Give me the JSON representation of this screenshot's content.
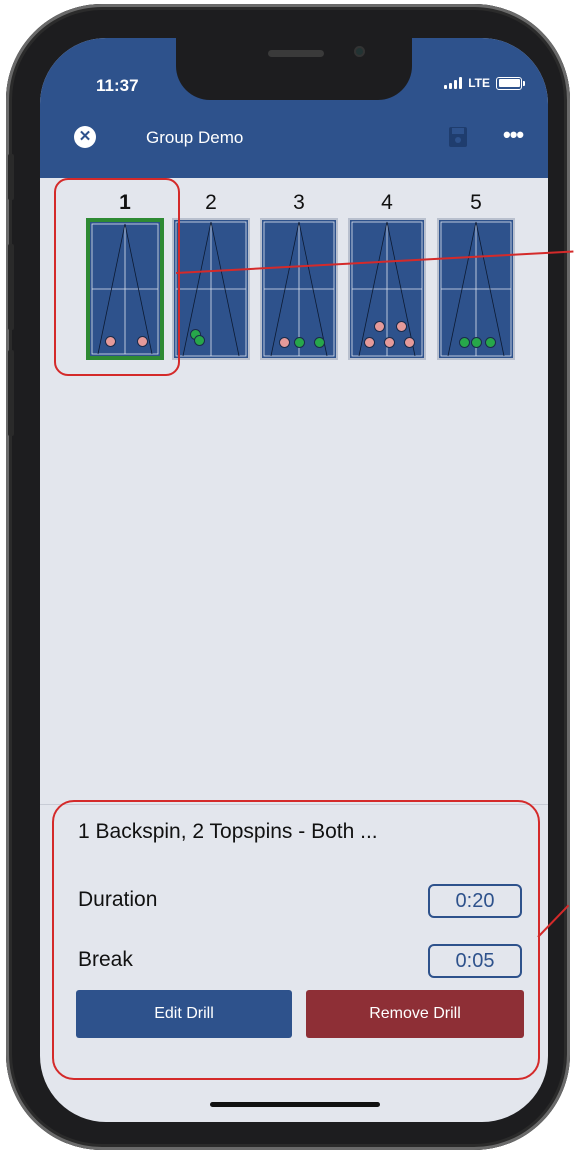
{
  "status": {
    "time": "11:37",
    "network": "LTE"
  },
  "header": {
    "title": "Group Demo",
    "close_icon": "close-icon",
    "save_icon": "save-icon",
    "more_icon": "more-icon"
  },
  "drills": [
    {
      "number": "1",
      "active": true
    },
    {
      "number": "2",
      "active": false
    },
    {
      "number": "3",
      "active": false
    },
    {
      "number": "4",
      "active": false
    },
    {
      "number": "5",
      "active": false
    }
  ],
  "detail": {
    "title": "1 Backspin, 2 Topspins - Both ...",
    "duration_label": "Duration",
    "duration_value": "0:20",
    "break_label": "Break",
    "break_value": "0:05",
    "edit_label": "Edit Drill",
    "remove_label": "Remove Drill"
  },
  "colors": {
    "header": "#2e528c",
    "active_border": "#2e8a33",
    "remove": "#8e2f36",
    "annotation": "#d42a2a"
  }
}
